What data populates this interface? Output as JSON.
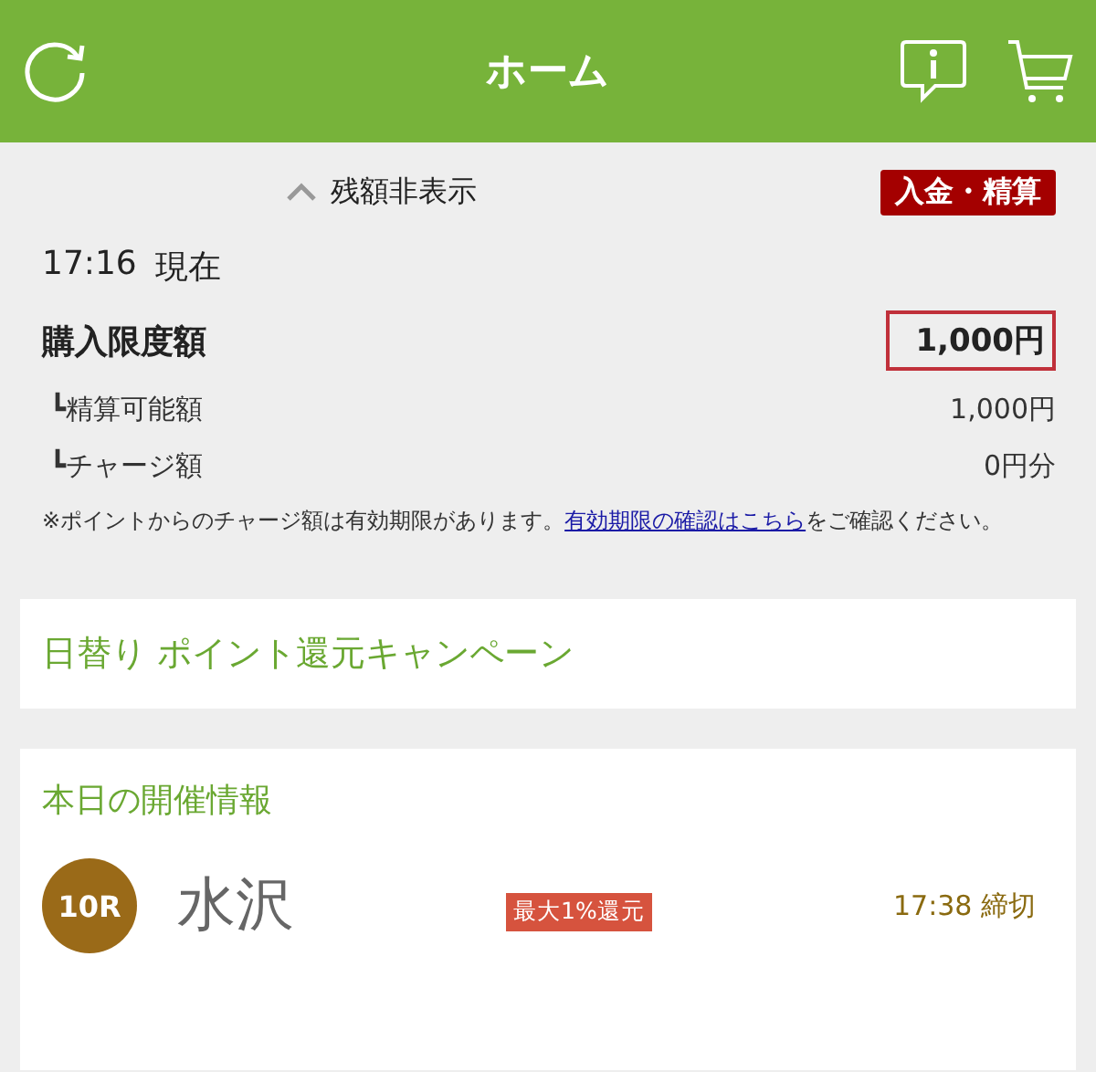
{
  "header": {
    "title": "ホーム"
  },
  "balance": {
    "toggle_label": "残額非表示",
    "deposit_button": "入金・精算",
    "as_of_time": "17:16",
    "as_of_label": "現在",
    "limit_label": "購入限度額",
    "limit_value": "1,000円",
    "sub_rows": [
      {
        "label": "┗精算可能額",
        "value": "1,000円"
      },
      {
        "label": "┗チャージ額",
        "value": "0円分"
      }
    ],
    "note": {
      "before": "※ポイントからのチャージ額は有効期限があります。",
      "link": "有効期限の確認はこちら",
      "after": "をご確認ください。"
    }
  },
  "campaign": {
    "title": "日替り ポイント還元キャンペーン"
  },
  "today": {
    "title": "本日の開催情報",
    "races": [
      {
        "race": "10R",
        "venue": "水沢",
        "badge": "最大1%還元",
        "deadline": "17:38 締切"
      }
    ]
  }
}
